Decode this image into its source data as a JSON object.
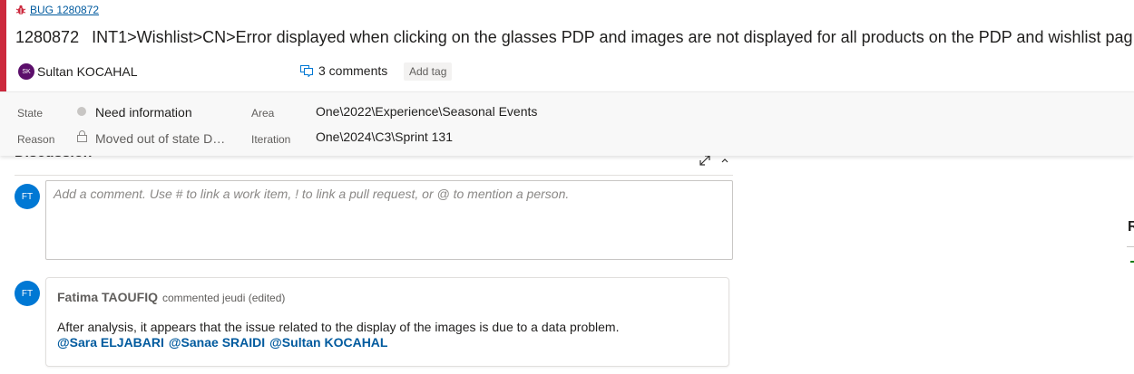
{
  "work_item": {
    "type_label": "BUG 1280872",
    "id": "1280872",
    "title": "INT1>Wishlist>CN>Error displayed when clicking on the glasses PDP and images are not displayed for all products on the PDP and wishlist pag",
    "assignee_initials": "SK",
    "assignee": "Sultan KOCAHAL",
    "comments_count": "3 comments",
    "add_tag": "Add tag",
    "accent_color": "#cc293d"
  },
  "fields": {
    "state_label": "State",
    "state_value": "Need information",
    "reason_label": "Reason",
    "reason_value": "Moved out of state De…",
    "area_label": "Area",
    "area_value": "One\\2022\\Experience\\Seasonal Events",
    "iteration_label": "Iteration",
    "iteration_value": "One\\2024\\C3\\Sprint 131"
  },
  "discussion": {
    "title": "Discussion",
    "current_user_initials": "FT",
    "placeholder": "Add a comment. Use # to link a work item, ! to link a pull request, or @ to mention a person.",
    "comments": [
      {
        "author_initials": "FT",
        "author": "Fatima TAOUFIQ",
        "meta": "commented jeudi (edited)",
        "text": "After analysis, it appears that the issue related to the display of the images is due to a data problem.",
        "mentions": [
          "@Sara ELJABARI",
          "@Sanae SRAIDI",
          "@Sultan KOCAHAL"
        ]
      }
    ]
  },
  "right_panel": {
    "cut_label": "R"
  }
}
